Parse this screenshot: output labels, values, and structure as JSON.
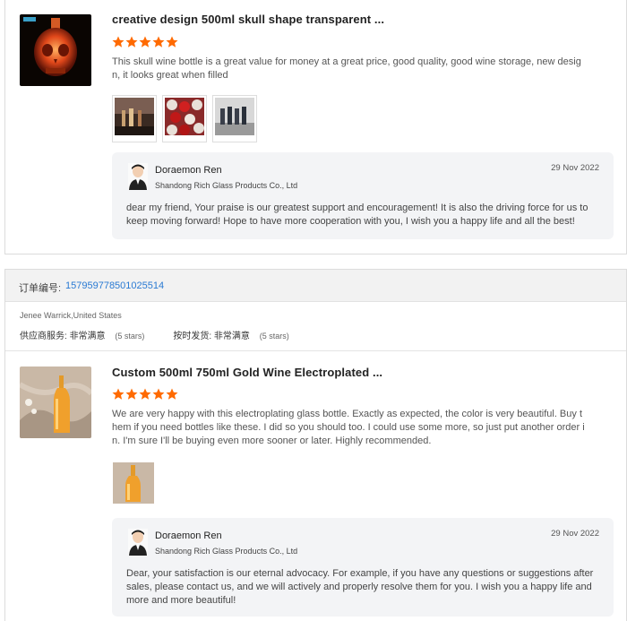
{
  "colors": {
    "star": "#ff6a00",
    "link": "#2a7ad3",
    "reply_bg": "#f3f4f6"
  },
  "reviews": [
    {
      "title": "creative design 500ml skull shape transparent ...",
      "rating": 5,
      "text": "This skull wine bottle is a great value for money at a great price, good quality, good wine storage, new design, it looks great when filled",
      "photo_count": 3,
      "reply": {
        "name": "Doraemon Ren",
        "company": "Shandong Rich Glass Products Co., Ltd",
        "date": "29 Nov 2022",
        "message": "dear my friend, Your praise is our greatest support and encouragement! It is also the driving force for us to keep moving forward! Hope to have more cooperation with you, I wish you a happy life and all the best!"
      }
    },
    {
      "order_label": "订单编号:",
      "order_number": "157959778501025514",
      "buyer": "Jenee Warrick,United States",
      "ratings": [
        {
          "label": "供应商服务:",
          "value": "非常满意",
          "stars_text": "(5 stars)"
        },
        {
          "label": "按时发货:",
          "value": "非常满意",
          "stars_text": "(5 stars)"
        }
      ],
      "title": "Custom 500ml 750ml Gold Wine Electroplated ...",
      "rating": 5,
      "text": "We are very happy with this electroplating glass bottle. Exactly as expected, the color is very beautiful. Buy them if you need bottles like these. I did so you should too. I could use some more, so just put another order in. I'm sure I'll be buying even more sooner or later. Highly recommended.",
      "photo_count": 1,
      "reply": {
        "name": "Doraemon Ren",
        "company": "Shandong Rich Glass Products Co., Ltd",
        "date": "29 Nov 2022",
        "message": "Dear, your satisfaction is our eternal advocacy. For example, if you have any questions or suggestions after sales, please contact us, and we will actively and properly resolve them for you. I wish you a happy life and more and more beautiful!"
      }
    }
  ]
}
